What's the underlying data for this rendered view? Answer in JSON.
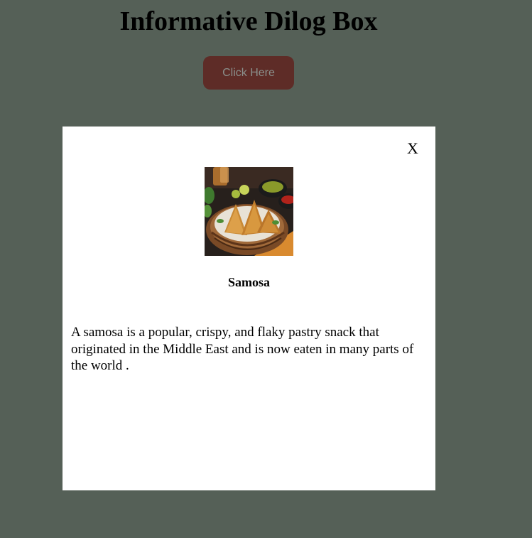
{
  "page": {
    "title": "Informative Dilog Box",
    "open_button_label": "Click Here"
  },
  "dialog": {
    "close_label": "X",
    "image_icon": "samosa-image",
    "item_name": "Samosa",
    "description": "A samosa is a popular, crispy, and flaky pastry snack that originated in the Middle East and is now eaten in many parts of the world ."
  },
  "colors": {
    "background": "#556057",
    "button_bg": "#5e2c27",
    "button_text": "#8a8f8b",
    "dialog_bg": "#ffffff"
  }
}
